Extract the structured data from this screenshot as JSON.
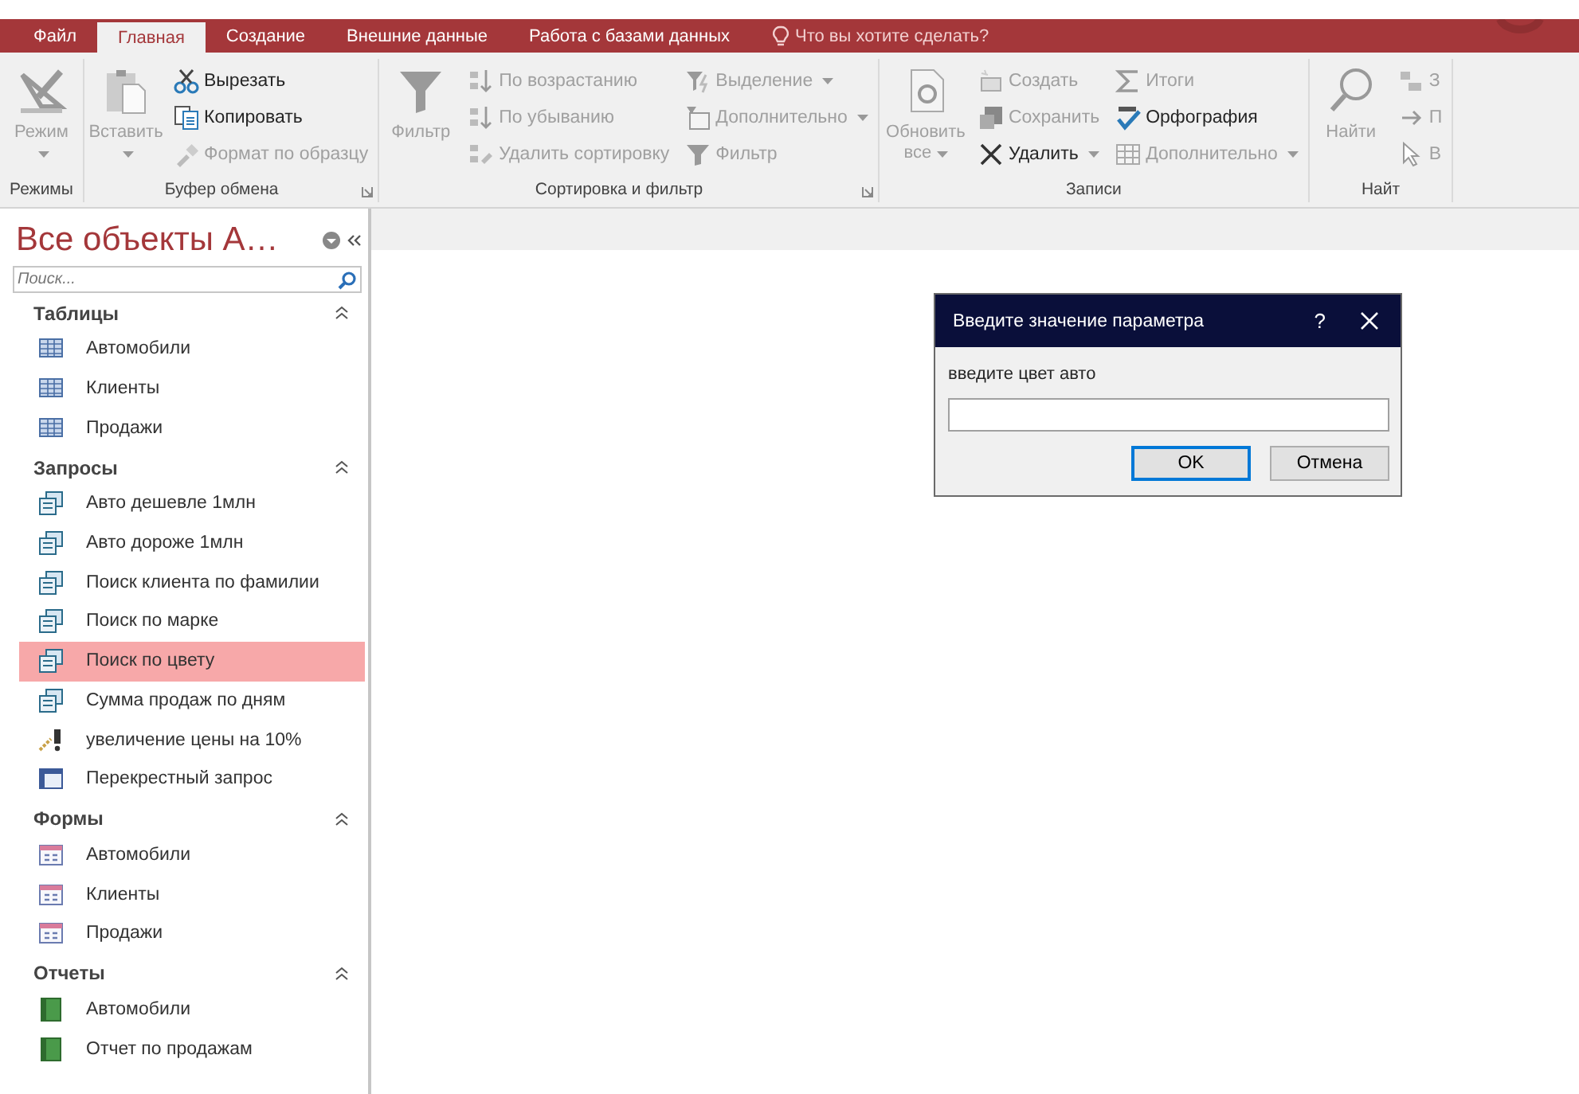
{
  "tabs": [
    {
      "label": "Файл",
      "selected": false
    },
    {
      "label": "Главная",
      "selected": true
    },
    {
      "label": "Создание",
      "selected": false
    },
    {
      "label": "Внешние данные",
      "selected": false
    },
    {
      "label": "Работа с базами данных",
      "selected": false
    }
  ],
  "tell_me": "Что вы хотите сделать?",
  "ribbon": {
    "groups": [
      {
        "label": "Режимы",
        "launcher": false,
        "large": [
          {
            "label": "Режим",
            "dropdown": true,
            "disabled": true
          }
        ]
      },
      {
        "label": "Буфер обмена",
        "launcher": true,
        "large": [
          {
            "label": "Вставить",
            "dropdown": true,
            "disabled": true
          }
        ],
        "columns": [
          [
            {
              "label": "Вырезать",
              "dropdown": false,
              "disabled": false
            },
            {
              "label": "Копировать",
              "dropdown": false,
              "disabled": false
            },
            {
              "label": "Формат по образцу",
              "dropdown": false,
              "disabled": true
            }
          ]
        ]
      },
      {
        "label": "Сортировка и фильтр",
        "launcher": true,
        "large": [
          {
            "label": "Фильтр",
            "dropdown": false,
            "disabled": true
          }
        ],
        "columns": [
          [
            {
              "label": "По возрастанию",
              "dropdown": false,
              "disabled": true
            },
            {
              "label": "По убыванию",
              "dropdown": false,
              "disabled": true
            },
            {
              "label": "Удалить сортировку",
              "dropdown": false,
              "disabled": true
            }
          ],
          [
            {
              "label": "Выделение",
              "dropdown": true,
              "disabled": true
            },
            {
              "label": "Дополнительно",
              "dropdown": true,
              "disabled": true
            },
            {
              "label": "Фильтр",
              "dropdown": false,
              "disabled": true
            }
          ]
        ]
      },
      {
        "label": "Записи",
        "launcher": false,
        "large": [
          {
            "label": "Обновить все",
            "dropdown": true,
            "disabled": true
          }
        ],
        "columns": [
          [
            {
              "label": "Создать",
              "dropdown": false,
              "disabled": true
            },
            {
              "label": "Сохранить",
              "dropdown": false,
              "disabled": true
            },
            {
              "label": "Удалить",
              "dropdown": true,
              "disabled": false
            }
          ],
          [
            {
              "label": "Итоги",
              "dropdown": false,
              "disabled": true
            },
            {
              "label": "Орфография",
              "dropdown": false,
              "disabled": false
            },
            {
              "label": "Дополнительно",
              "dropdown": true,
              "disabled": true
            }
          ]
        ]
      },
      {
        "label": "Найт",
        "launcher": false,
        "large": [
          {
            "label": "Найти",
            "dropdown": false,
            "disabled": true
          }
        ],
        "columns": [
          [
            {
              "label": "З",
              "dropdown": false,
              "disabled": true
            },
            {
              "label": "П",
              "dropdown": false,
              "disabled": true
            },
            {
              "label": "В",
              "dropdown": false,
              "disabled": true
            }
          ]
        ]
      }
    ]
  },
  "nav": {
    "title": "Все объекты A…",
    "search": {
      "placeholder": "Поиск..."
    },
    "sections": [
      {
        "label": "Таблицы",
        "expanded": true,
        "items": [
          {
            "label": "Автомобили",
            "kind": "table",
            "selected": false
          },
          {
            "label": "Клиенты",
            "kind": "table",
            "selected": false
          },
          {
            "label": "Продажи",
            "kind": "table",
            "selected": false
          }
        ]
      },
      {
        "label": "Запросы",
        "expanded": true,
        "items": [
          {
            "label": "Авто дешевле 1млн",
            "kind": "query",
            "selected": false
          },
          {
            "label": "Авто дороже 1млн",
            "kind": "query",
            "selected": false
          },
          {
            "label": "Поиск клиента по фамилии",
            "kind": "query",
            "selected": false
          },
          {
            "label": "Поиск по марке",
            "kind": "query",
            "selected": false
          },
          {
            "label": "Поиск по цвету",
            "kind": "query",
            "selected": true
          },
          {
            "label": "Сумма продаж по дням",
            "kind": "query",
            "selected": false
          },
          {
            "label": "увеличение цены на 10%",
            "kind": "update",
            "selected": false
          },
          {
            "label": "Перекрестный запрос",
            "kind": "crosstab",
            "selected": false
          }
        ]
      },
      {
        "label": "Формы",
        "expanded": true,
        "items": [
          {
            "label": "Автомобили",
            "kind": "form",
            "selected": false
          },
          {
            "label": "Клиенты",
            "kind": "form",
            "selected": false
          },
          {
            "label": "Продажи",
            "kind": "form",
            "selected": false
          }
        ]
      },
      {
        "label": "Отчеты",
        "expanded": true,
        "items": [
          {
            "label": "Автомобили",
            "kind": "report",
            "selected": false
          },
          {
            "label": "Отчет по продажам",
            "kind": "report",
            "selected": false
          }
        ]
      }
    ]
  },
  "dialog": {
    "title": "Введите значение параметра",
    "help": "?",
    "prompt": "введите цвет авто",
    "buttons": [
      {
        "label": "OK",
        "default": true
      },
      {
        "label": "Отмена",
        "default": false
      }
    ]
  }
}
